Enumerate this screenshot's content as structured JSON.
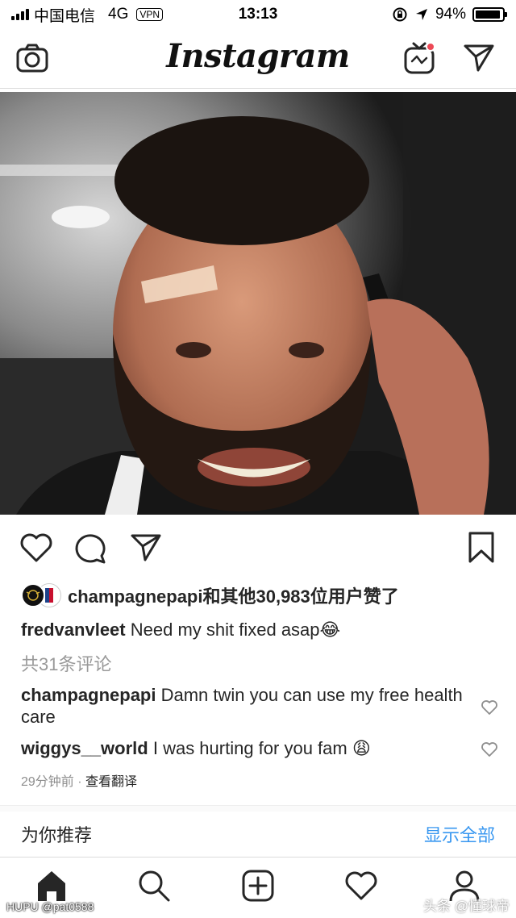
{
  "status_bar": {
    "carrier": "中国电信",
    "network": "4G",
    "vpn": "VPN",
    "time": "13:13",
    "battery": "94%"
  },
  "header": {
    "logo": "Instagram",
    "has_notification_dot": true
  },
  "post": {
    "image_alt": "photo",
    "likes_text": "champagnepapi和其他30,983位用户赞了",
    "caption_user": "fredvanvleet",
    "caption_text": "Need my shit fixed asap😂",
    "comments_count": "共31条评论",
    "comments": [
      {
        "user": "champagnepapi",
        "text": "Damn twin you can use my free health care"
      },
      {
        "user": "wiggys__world",
        "text": "I was hurting for you fam 😩"
      }
    ],
    "time_ago": "29分钟前",
    "separator": "·",
    "translate": "查看翻译"
  },
  "recommend": {
    "title": "为你推荐",
    "show_all": "显示全部"
  },
  "watermark": {
    "left": "HUPU @pat0588",
    "right": "头条 @懂球帝"
  },
  "colors": {
    "link_blue": "#3897f0",
    "notification_red": "#ed4956",
    "secondary_gray": "#999999"
  }
}
